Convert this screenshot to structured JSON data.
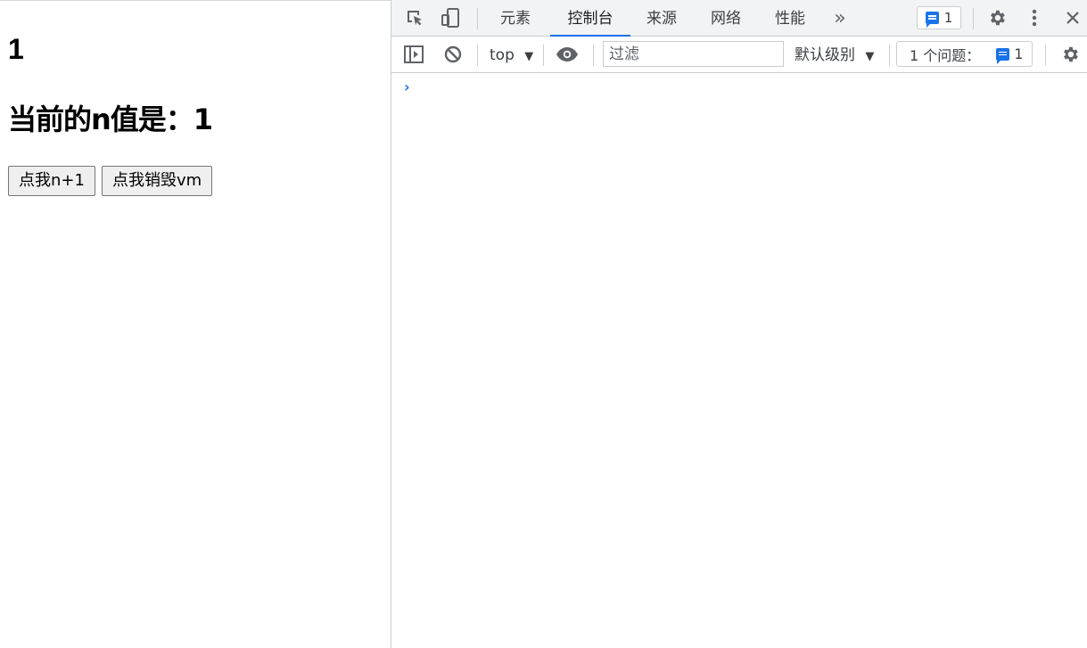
{
  "page": {
    "h1": "1",
    "n_label": "当前的n值是：1",
    "buttons": {
      "increment": "点我n+1",
      "destroy": "点我销毁vm"
    }
  },
  "devtools": {
    "tabs": [
      {
        "label": "元素",
        "active": false
      },
      {
        "label": "控制台",
        "active": true
      },
      {
        "label": "来源",
        "active": false
      },
      {
        "label": "网络",
        "active": false
      },
      {
        "label": "性能",
        "active": false
      }
    ],
    "more_tabs_glyph": "»",
    "issue_count": "1",
    "toolbar": {
      "context": "top",
      "filter_placeholder": "过滤",
      "levels": "默认级别",
      "issues_label": "1 个问题：",
      "issues_count": "1"
    },
    "prompt_glyph": "›",
    "colors": {
      "accent": "#1a73e8",
      "icon": "#5f6368",
      "toolbar_bg": "#f1f3f4"
    },
    "icons": [
      "inspect-icon",
      "device-toggle-icon",
      "more-tabs-icon",
      "issues-icon",
      "settings-icon",
      "kebab-menu-icon",
      "close-icon",
      "sidebar-toggle-icon",
      "clear-console-icon",
      "dropdown-arrow-icon",
      "eye-icon"
    ]
  }
}
